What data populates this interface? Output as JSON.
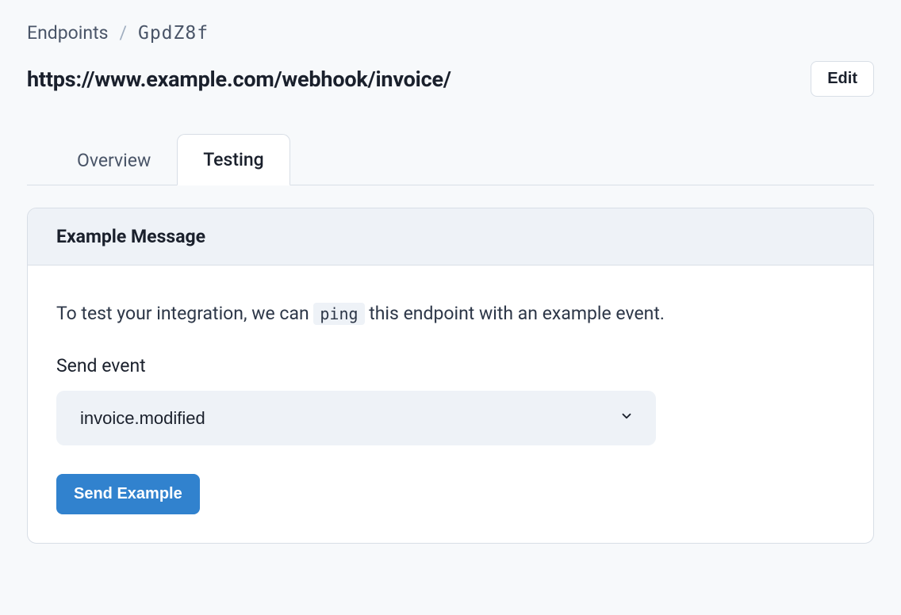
{
  "breadcrumb": {
    "root": "Endpoints",
    "separator": "/",
    "id": "GpdZ8f"
  },
  "header": {
    "title": "https://www.example.com/webhook/invoice/",
    "edit_label": "Edit"
  },
  "tabs": [
    {
      "label": "Overview",
      "active": false
    },
    {
      "label": "Testing",
      "active": true
    }
  ],
  "panel": {
    "title": "Example Message",
    "intro_pre": "To test your integration, we can ",
    "intro_code": "ping",
    "intro_post": " this endpoint with an example event.",
    "field_label": "Send event",
    "select": {
      "value": "invoice.modified",
      "options": [
        "invoice.modified"
      ]
    },
    "send_button_label": "Send Example"
  }
}
